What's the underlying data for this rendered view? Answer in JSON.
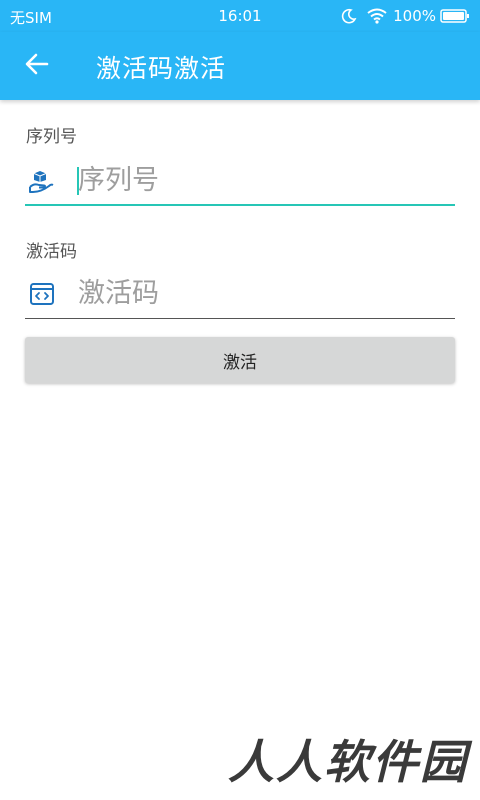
{
  "status_bar": {
    "carrier": "无SIM",
    "time": "16:01",
    "battery": "100%",
    "icons": [
      "moon-icon",
      "wifi-icon",
      "battery-icon"
    ]
  },
  "app_bar": {
    "title": "激活码激活",
    "back_icon": "arrow-left-icon",
    "background_color": "#29b6f6"
  },
  "form": {
    "serial": {
      "label": "序列号",
      "placeholder": "序列号",
      "value": "",
      "icon": "hand-box-icon",
      "focused": true
    },
    "code": {
      "label": "激活码",
      "placeholder": "激活码",
      "value": "",
      "icon": "code-window-icon",
      "focused": false
    },
    "submit_label": "激活"
  },
  "watermark": "人人软件园",
  "colors": {
    "accent": "#26c6b6",
    "icon": "#1e73be",
    "button_bg": "#d6d7d7"
  }
}
